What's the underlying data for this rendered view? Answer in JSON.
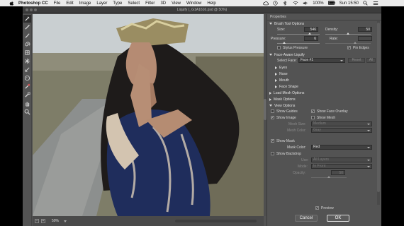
{
  "menubar": {
    "app": "Photoshop CC",
    "items": [
      "File",
      "Edit",
      "Image",
      "Layer",
      "Type",
      "Select",
      "Filter",
      "3D",
      "View",
      "Window",
      "Help"
    ],
    "battery": "100%",
    "clock": "Sun 15:50"
  },
  "window": {
    "title": "Liquify (_G1A1616.psd @ 50%)"
  },
  "tools": [
    "forward-warp",
    "reconstruct",
    "smooth",
    "twirl",
    "pucker",
    "bloat",
    "push-left",
    "face",
    "freeze-mask",
    "thaw-mask",
    "hand",
    "zoom"
  ],
  "status": {
    "zoom": "50%"
  },
  "panel": {
    "title": "Properties",
    "brush": {
      "header": "Brush Tool Options",
      "size_label": "Size:",
      "size": "546",
      "density_label": "Density:",
      "density": "50",
      "pressure_label": "Pressure:",
      "pressure": "6",
      "rate_label": "Rate:",
      "rate": "",
      "stylus_label": "Stylus Pressure",
      "pin_edges_label": "Pin Edges",
      "pin_edges_checked": true
    },
    "face": {
      "header": "Face-Aware Liquify",
      "select_label": "Select Face:",
      "select_value": "Face #1",
      "reset_label": "Reset",
      "all_label": "All",
      "items": [
        "Eyes",
        "Nose",
        "Mouth",
        "Face Shape"
      ]
    },
    "load_mesh": {
      "header": "Load Mesh Options"
    },
    "mask": {
      "header": "Mask Options"
    },
    "view": {
      "header": "View Options",
      "show_guides": "Show Guides",
      "show_face_overlay": "Show Face Overlay",
      "show_image": "Show Image",
      "show_mesh": "Show Mesh",
      "mesh_size_label": "Mesh Size:",
      "mesh_size": "Medium",
      "mesh_color_label": "Mesh Color:",
      "mesh_color": "Gray",
      "show_mask": "Show Mask",
      "mask_color_label": "Mask Color:",
      "mask_color": "Red",
      "show_backdrop": "Show Backdrop",
      "use_label": "Use:",
      "use_value": "All Layers",
      "mode_label": "Mode:",
      "mode_value": "In Front",
      "opacity_label": "Opacity:",
      "opacity": "50"
    },
    "preview_label": "Preview",
    "cancel_label": "Cancel",
    "ok_label": "OK"
  },
  "colors": {
    "ui_bg": "#535353",
    "panel_dark": "#404040",
    "accent_white": "#ffffff"
  }
}
